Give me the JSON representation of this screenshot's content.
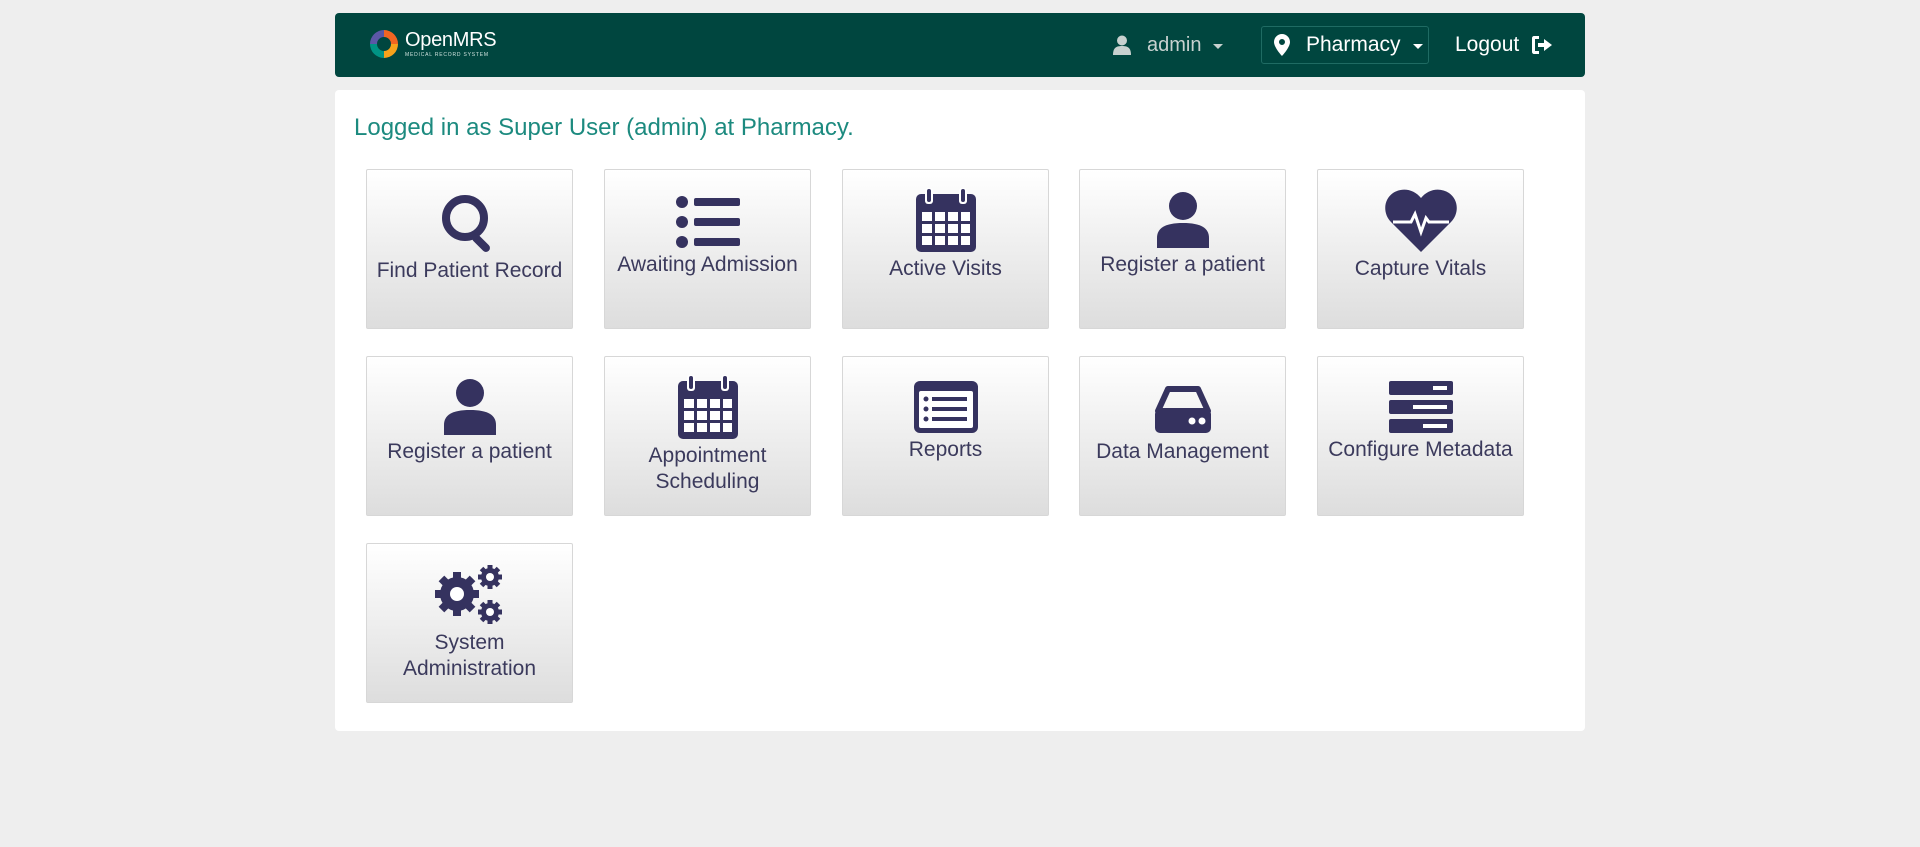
{
  "header": {
    "brand_name": "OpenMRS",
    "brand_tagline": "medical record system",
    "user": "admin",
    "location": "Pharmacy",
    "logout": "Logout"
  },
  "welcome": "Logged in as Super User (admin) at Pharmacy.",
  "tiles": [
    {
      "label": "Find Patient Record",
      "icon": "search-icon"
    },
    {
      "label": "Awaiting Admission",
      "icon": "list-icon"
    },
    {
      "label": "Active Visits",
      "icon": "calendar-icon"
    },
    {
      "label": "Register a patient",
      "icon": "user-icon"
    },
    {
      "label": "Capture Vitals",
      "icon": "heartbeat-icon"
    },
    {
      "label": "Register a patient",
      "icon": "user-icon"
    },
    {
      "label": "Appointment Scheduling",
      "icon": "calendar-icon"
    },
    {
      "label": "Reports",
      "icon": "report-list-icon"
    },
    {
      "label": "Data Management",
      "icon": "hard-drive-icon"
    },
    {
      "label": "Configure Metadata",
      "icon": "server-stack-icon"
    },
    {
      "label": "System Administration",
      "icon": "gears-icon"
    }
  ],
  "colors": {
    "header_bg": "#00463f",
    "welcome_text": "#1c8a7f",
    "icon": "#35325f",
    "page_bg": "#eeeeee"
  }
}
